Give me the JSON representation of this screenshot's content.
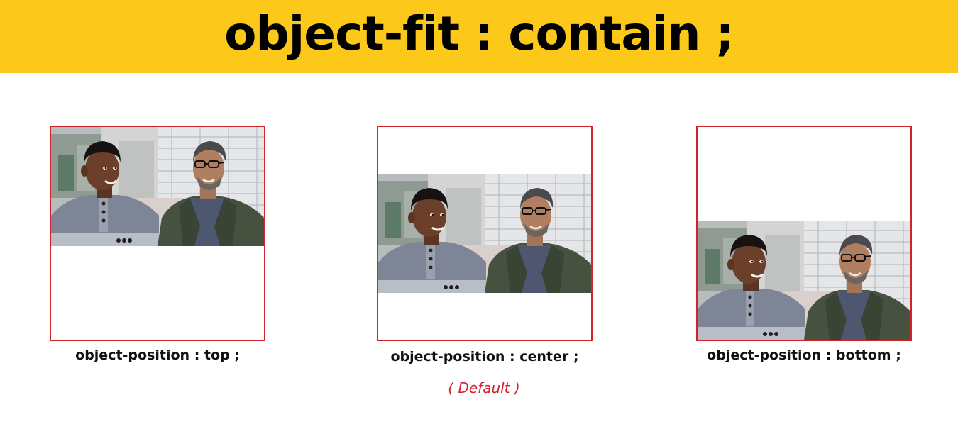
{
  "header": {
    "title": "object-fit : contain ;",
    "background_color": "#fcc81a"
  },
  "colors": {
    "frame_border": "#d2232a",
    "note_text": "#d2232a"
  },
  "panels": [
    {
      "caption": "object-position : top ;",
      "image": "two-men-seated-photo",
      "alignment": "top"
    },
    {
      "caption": "object-position : center ;",
      "image": "two-men-seated-photo",
      "alignment": "center",
      "note": "(  Default )"
    },
    {
      "caption": "object-position : bottom ;",
      "image": "two-men-seated-photo",
      "alignment": "bottom"
    }
  ]
}
